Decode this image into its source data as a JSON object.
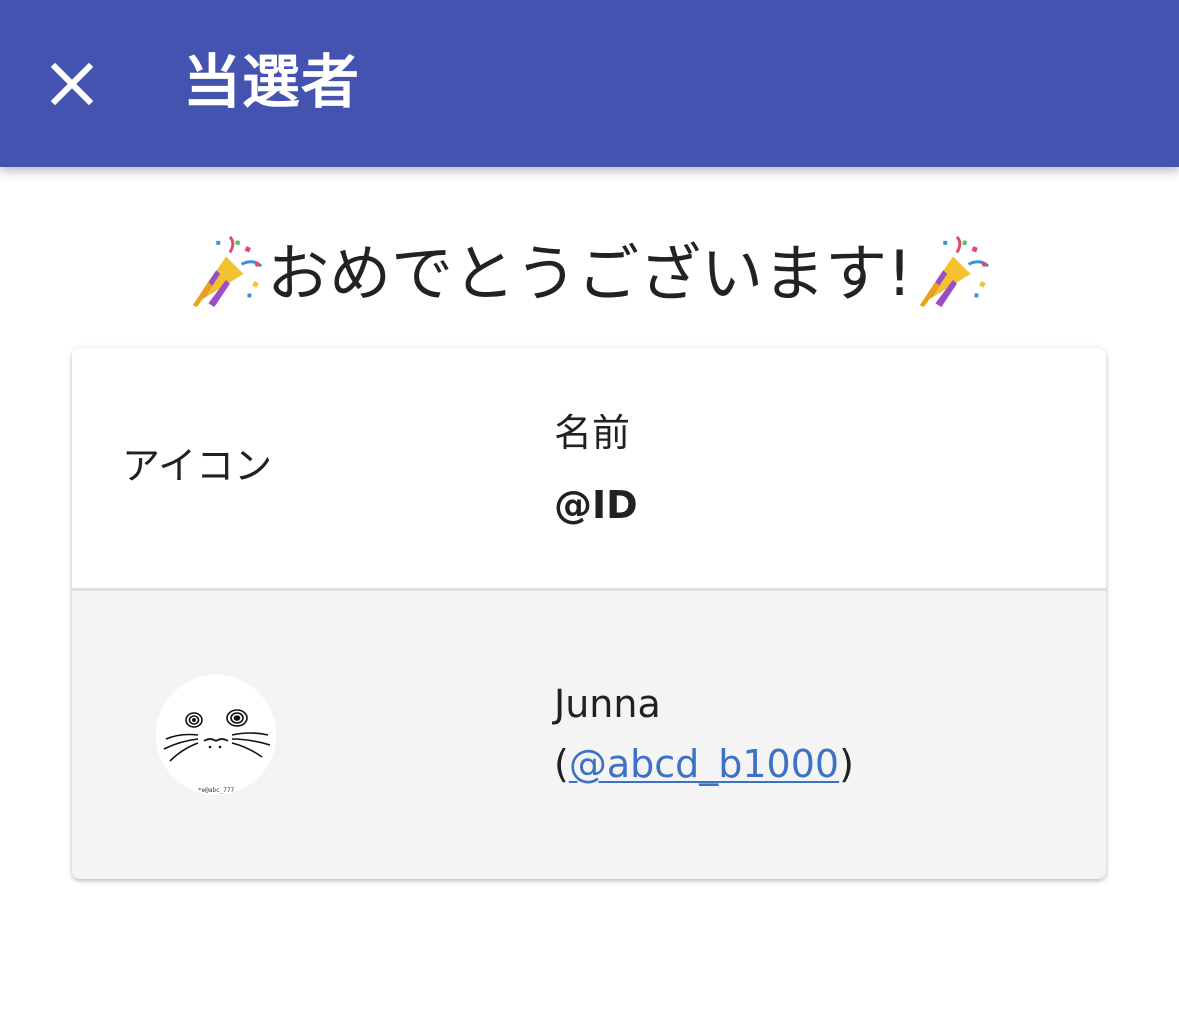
{
  "app_bar": {
    "title": "当選者",
    "close_icon": "close-icon",
    "background_color": "#4452b0"
  },
  "congrats": {
    "text": "おめでとうございます!",
    "emoji_icon": "party-popper-icon"
  },
  "table": {
    "headers": {
      "icon": "アイコン",
      "name": "名前",
      "id": "@ID"
    },
    "rows": [
      {
        "avatar_icon": "seal-face-avatar",
        "avatar_caption": "*e@abc_777",
        "name": "Junna",
        "id_open": "(",
        "id_handle": "@abcd_b1000",
        "id_close": ")"
      }
    ]
  },
  "colors": {
    "link": "#3b72c4",
    "row_background": "#f4f4f4"
  }
}
